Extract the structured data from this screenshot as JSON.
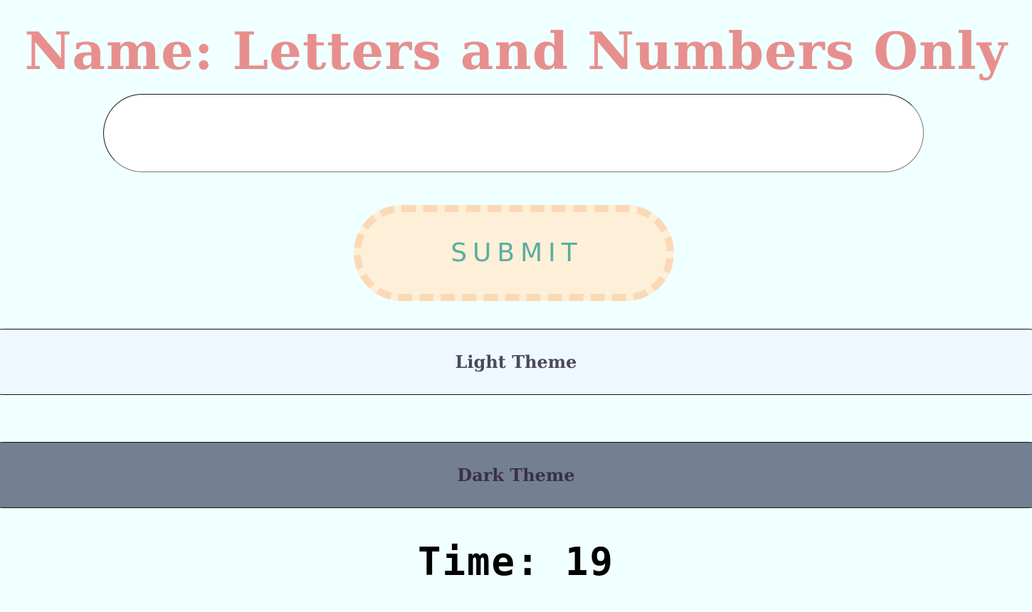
{
  "title": "Name: Letters and Numbers Only",
  "name_field": {
    "value": "",
    "placeholder": ""
  },
  "submit_label": "SUBMIT",
  "themes": {
    "light_label": "Light Theme",
    "dark_label": "Dark Theme"
  },
  "timer": {
    "label": "Time:",
    "value": "19"
  },
  "colors": {
    "background": "#f0ffff",
    "title": "#e78f8e",
    "submit_bg": "#feefd8",
    "submit_border": "#fcd9b6",
    "submit_text": "#5aaea0",
    "light_theme_bg": "#f0f8ff",
    "dark_theme_bg": "#738091"
  }
}
